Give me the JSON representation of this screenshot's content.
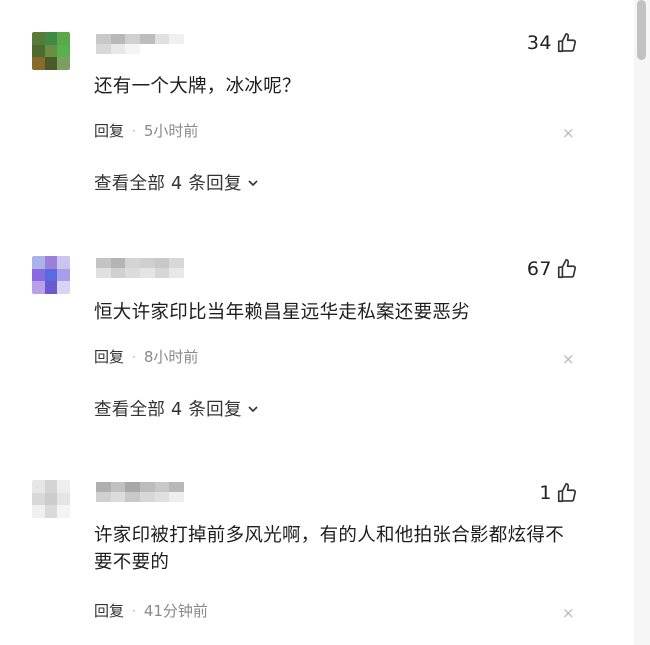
{
  "comments": [
    {
      "likes": "34",
      "text": "还有一个大牌，冰冰呢？",
      "reply_label": "回复",
      "separator": "·",
      "time": "5小时前",
      "view_replies": "查看全部 4 条回复",
      "avatar_colors": [
        "#5a7a3a",
        "#3f8a45",
        "#5aa84a",
        "#4d6b30",
        "#6a8f40",
        "#58b050",
        "#8a6a2a",
        "#4a5a2a",
        "#7aa060"
      ],
      "name_colors": [
        "#c8c8c8",
        "#b8b8b8",
        "#d0d0d0",
        "#bdbdbd",
        "#e0e0e0",
        "#f0f0f0",
        "#d8d8d8",
        "#e8e8e8",
        "#f4f4f4",
        "#ffffff",
        "#ffffff",
        "#ffffff"
      ]
    },
    {
      "likes": "67",
      "text": "恒大许家印比当年赖昌星远华走私案还要恶劣",
      "reply_label": "回复",
      "separator": "·",
      "time": "8小时前",
      "view_replies": "查看全部 4 条回复",
      "avatar_colors": [
        "#a8b4e8",
        "#9b7fd8",
        "#c9c4f0",
        "#8a6ae0",
        "#5a6ae0",
        "#a89ee8",
        "#b9a0e8",
        "#6a5ad0",
        "#d8d4f4"
      ],
      "name_colors": [
        "#c4c4c4",
        "#b4b4b4",
        "#d4d4d4",
        "#cfcfcf",
        "#c8c8c8",
        "#d8d8d8",
        "#e0e0e0",
        "#d0d0d0",
        "#dcdcdc",
        "#e4e4e4",
        "#d6d6d6",
        "#e8e8e8"
      ]
    },
    {
      "likes": "1",
      "text": "许家印被打掉前多风光啊，有的人和他拍张合影都炫得不要不要的",
      "reply_label": "回复",
      "separator": "·",
      "time": "41分钟前",
      "avatar_colors": [
        "#e6e6e6",
        "#d4d4d4",
        "#eeeeee",
        "#d8d8d8",
        "#cccccc",
        "#e4e4e4",
        "#f0f0f0",
        "#dadada",
        "#f4f4f4"
      ],
      "name_colors": [
        "#b0b0b0",
        "#c0c0c0",
        "#a8a8a8",
        "#bcbcbc",
        "#c8c8c8",
        "#b8b8b8",
        "#d0d0d0",
        "#dcdcdc",
        "#c8c8c8",
        "#d8d8d8",
        "#e0e0e0",
        "#eeeeee"
      ]
    }
  ],
  "icons": {
    "like": "thumbs-up-icon",
    "close": "close-icon",
    "chevron": "chevron-down-icon"
  },
  "close_glyph": "×"
}
